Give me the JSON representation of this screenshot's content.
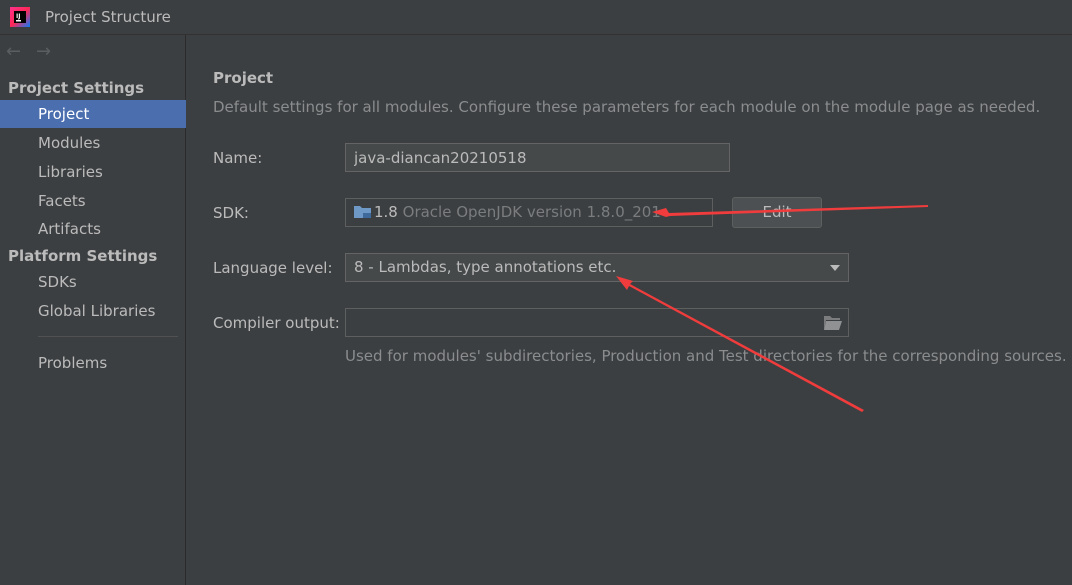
{
  "window": {
    "title": "Project Structure",
    "app_icon": "intellij-idea-icon"
  },
  "sidebar": {
    "nav": {
      "back": "←",
      "forward": "→"
    },
    "sections": [
      {
        "header": "Project Settings",
        "items": [
          "Project",
          "Modules",
          "Libraries",
          "Facets",
          "Artifacts"
        ]
      },
      {
        "header": "Platform Settings",
        "items": [
          "SDKs",
          "Global Libraries"
        ]
      }
    ],
    "problems": "Problems",
    "selected": "Project"
  },
  "main": {
    "title": "Project",
    "description": "Default settings for all modules. Configure these parameters for each module on the module page as needed.",
    "name": {
      "label": "Name:",
      "value": "java-diancan20210518"
    },
    "sdk": {
      "label": "SDK:",
      "version": "1.8",
      "detail": "Oracle OpenJDK version 1.8.0_201",
      "edit_label": "Edit"
    },
    "language_level": {
      "label": "Language level:",
      "value": "8 - Lambdas, type annotations etc."
    },
    "compiler_output": {
      "label": "Compiler output:",
      "value": "",
      "hint": "Used for modules' subdirectories, Production and Test directories for the corresponding sources."
    }
  },
  "colors": {
    "background": "#3c3f41",
    "selection": "#4b6eaf",
    "annotation_arrow": "#f03c3c"
  }
}
